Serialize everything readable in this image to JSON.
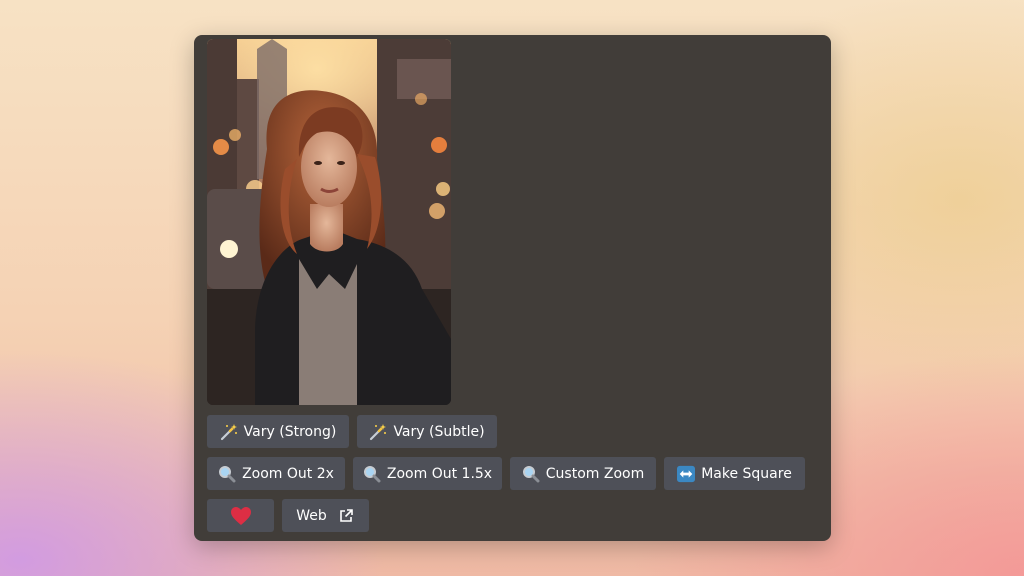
{
  "message": {
    "image": {
      "icon": "generated-portrait-image"
    },
    "buttons_row1": [
      {
        "label": "Vary (Strong)",
        "icon": "magic-wand-icon"
      },
      {
        "label": "Vary (Subtle)",
        "icon": "magic-wand-icon"
      }
    ],
    "buttons_row2": [
      {
        "label": "Zoom Out 2x",
        "icon": "magnifier-icon"
      },
      {
        "label": "Zoom Out 1.5x",
        "icon": "magnifier-icon"
      },
      {
        "label": "Custom Zoom",
        "icon": "magnifier-icon"
      },
      {
        "label": "Make Square",
        "icon": "left-right-arrow-icon"
      }
    ],
    "buttons_row3": [
      {
        "label": "",
        "icon": "heart-icon"
      },
      {
        "label": "Web",
        "icon": "external-link-icon"
      }
    ]
  },
  "colors": {
    "panel": "#413d39",
    "button": "#4e5058",
    "heart": "#dd2e44",
    "arrow_box": "#3b88c3"
  }
}
